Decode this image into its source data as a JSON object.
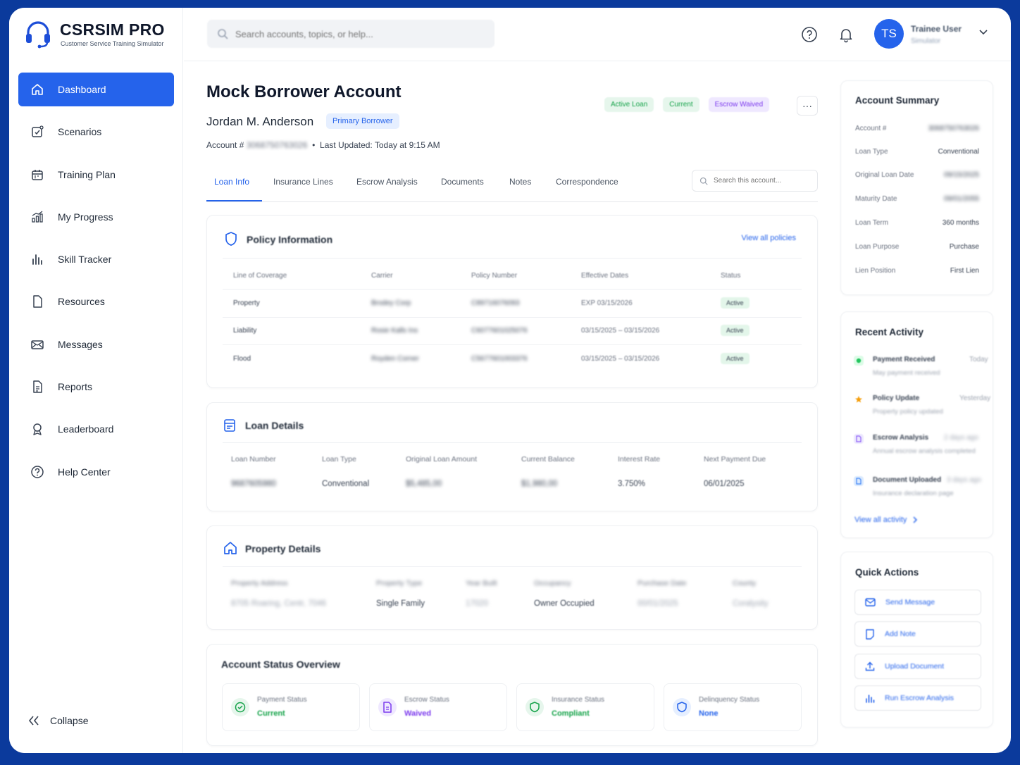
{
  "app": {
    "title": "CSRSIM PRO",
    "subtitle": "Customer Service Training Simulator"
  },
  "sidebar": {
    "items": [
      {
        "label": "Dashboard",
        "icon": "home-icon",
        "active": true
      },
      {
        "label": "Scenarios",
        "icon": "checklist-icon"
      },
      {
        "label": "Training Plan",
        "icon": "calendar-icon"
      },
      {
        "label": "My Progress",
        "icon": "progress-chart-icon"
      },
      {
        "label": "Skill Tracker",
        "icon": "bar-chart-icon"
      },
      {
        "label": "Resources",
        "icon": "document-icon"
      },
      {
        "label": "Messages",
        "icon": "mail-icon"
      },
      {
        "label": "Reports",
        "icon": "report-icon"
      },
      {
        "label": "Leaderboard",
        "icon": "trophy-icon"
      },
      {
        "label": "Help Center",
        "icon": "help-icon"
      }
    ],
    "collapse_label": "Collapse"
  },
  "topbar": {
    "search_placeholder": "Search accounts, topics, or help...",
    "user_initials": "TS",
    "user_name": "Trainee User",
    "user_role": "Simulator"
  },
  "account": {
    "title": "Mock Borrower Account",
    "borrower_name": "Jordan M. Anderson",
    "borrower_role": "Primary Borrower",
    "account_label": "Account #",
    "account_number": "3068750763026",
    "last_updated": "Last Updated: Today at 9:15 AM",
    "badges": [
      "Active Loan",
      "Current",
      "Escrow Waived"
    ],
    "more_label": "···"
  },
  "tabs": {
    "items": [
      "Loan Info",
      "Insurance Lines",
      "Escrow Analysis",
      "Documents",
      "Notes",
      "Correspondence"
    ],
    "active": "Loan Info",
    "search_placeholder": "Search this account..."
  },
  "policy": {
    "title": "Policy Information",
    "view_all": "View all policies",
    "headers": [
      "Line of Coverage",
      "Carrier",
      "Policy Number",
      "Effective Dates",
      "Status"
    ],
    "rows": [
      {
        "coverage": "Property",
        "carrier": "Brodey Corp",
        "policy": "C89716076093",
        "dates": "EXP 03/15/2026",
        "status": "Active"
      },
      {
        "coverage": "Liability",
        "carrier": "Rosie Kalls Ins",
        "policy": "C6077601025076",
        "dates": "03/15/2025 – 03/15/2026",
        "status": "Active"
      },
      {
        "coverage": "Flood",
        "carrier": "Royden Corner",
        "policy": "C5677601003376",
        "dates": "03/15/2025 – 03/15/2026",
        "status": "Active"
      }
    ]
  },
  "loan": {
    "title": "Loan Details",
    "headers": [
      "Loan Number",
      "Loan Type",
      "Original Loan Amount",
      "Current Balance",
      "Interest Rate",
      "Next Payment Due"
    ],
    "values": [
      "9687605980",
      "Conventional",
      "$5,485,00",
      "$1,980,00",
      "3.750%",
      "06/01/2025"
    ]
  },
  "property": {
    "title": "Property Details",
    "headers": [
      "Property Address",
      "Property Type",
      "Year Built",
      "Occupancy",
      "Purchase Date",
      "County"
    ],
    "values": [
      "8705 Roaring, Centr, 7046",
      "Single Family",
      "17020",
      "Owner Occupied",
      "00/01/2025",
      "Coralysity"
    ]
  },
  "status_overview": {
    "title": "Account Status Overview",
    "items": [
      {
        "label": "Payment Status",
        "value": "Current",
        "color": "#16a34a",
        "bg": "#e6f6ec",
        "icon": "check-circle-icon"
      },
      {
        "label": "Escrow Status",
        "value": "Waived",
        "color": "#7c3aed",
        "bg": "#efe8ff",
        "icon": "file-icon"
      },
      {
        "label": "Insurance Status",
        "value": "Compliant",
        "color": "#16a34a",
        "bg": "#e6f6ec",
        "icon": "shield-check-icon"
      },
      {
        "label": "Delinquency Status",
        "value": "None",
        "color": "#2563eb",
        "bg": "#e6efff",
        "icon": "shield-icon"
      }
    ]
  },
  "summary": {
    "title": "Account Summary",
    "rows": [
      {
        "k": "Account #",
        "v": "3068750763026"
      },
      {
        "k": "Loan Type",
        "v": "Conventional"
      },
      {
        "k": "Original Loan Date",
        "v": "09/15/2025"
      },
      {
        "k": "Maturity Date",
        "v": "09/01/2055"
      },
      {
        "k": "Loan Term",
        "v": "360 months"
      },
      {
        "k": "Loan Purpose",
        "v": "Purchase"
      },
      {
        "k": "Lien Position",
        "v": "First Lien"
      }
    ]
  },
  "activity": {
    "title": "Recent Activity",
    "items": [
      {
        "t": "Payment Received",
        "when": "Today",
        "d": "May payment received",
        "color": "#22c55e"
      },
      {
        "t": "Policy Update",
        "when": "Yesterday",
        "d": "Property policy updated",
        "color": "#f59e0b"
      },
      {
        "t": "Escrow Analysis",
        "when": "2 days ago",
        "d": "Annual escrow analysis completed",
        "color": "#8b5cf6"
      },
      {
        "t": "Document Uploaded",
        "when": "3 days ago",
        "d": "Insurance declaration page",
        "color": "#3b82f6"
      }
    ],
    "view_all": "View all activity"
  },
  "quick_actions": {
    "title": "Quick Actions",
    "items": [
      {
        "label": "Send Message",
        "icon": "mail-icon"
      },
      {
        "label": "Add Note",
        "icon": "note-icon"
      },
      {
        "label": "Upload Document",
        "icon": "upload-icon"
      },
      {
        "label": "Run Escrow Analysis",
        "icon": "bar-chart-icon"
      }
    ]
  },
  "colors": {
    "primary": "#2563eb",
    "background": "#0b3a9c"
  }
}
